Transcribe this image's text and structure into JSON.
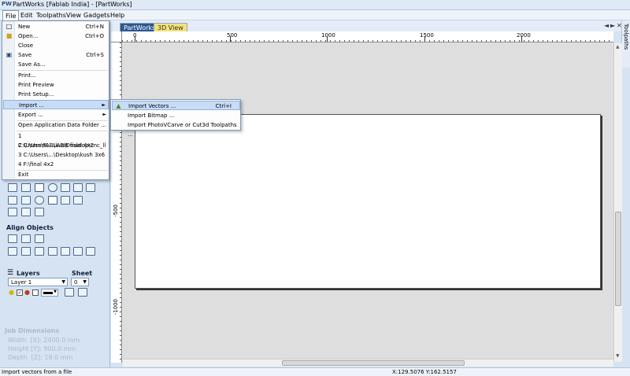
{
  "app": {
    "logo": "PW",
    "title": "PartWorks [Fablab India] - [PartWorks]"
  },
  "menubar": [
    "File",
    "Edit",
    "Toolpaths",
    "View",
    "Gadgets",
    "Help"
  ],
  "file_menu": {
    "new": "New",
    "new_sc": "Ctrl+N",
    "open": "Open...",
    "open_sc": "Ctrl+O",
    "close": "Close",
    "save": "Save",
    "save_sc": "Ctrl+S",
    "save_as": "Save As...",
    "print": "Print...",
    "print_preview": "Print Preview",
    "print_setup": "Print Setup...",
    "import": "Import ...",
    "export": "Export ...",
    "open_app_data": "Open Application Data Folder ...",
    "recent1": "1 C:\\Users\\FABLAB\\Desktop\\cnc_ll",
    "recent2": "2 C:\\Users\\...\\kush final 4x2",
    "recent3": "3 C:\\Users\\...\\Desktop\\kush 3x6",
    "recent4": "4 F:\\final 4x2",
    "exit": "Exit"
  },
  "import_menu": {
    "vectors": "Import Vectors ...",
    "vectors_sc": "Ctrl+I",
    "bitmap": "Import Bitmap ...",
    "toolpaths": "Import PhotoVCarve or Cut3d Toolpaths ..."
  },
  "tabs": {
    "partworks": "PartWorks",
    "view3d": "3D View"
  },
  "toolpaths_tab": "Toolpaths",
  "ruler": {
    "h": [
      "0",
      "500",
      "1000",
      "1500",
      "2000"
    ],
    "v": [
      "-500",
      "-1000"
    ]
  },
  "left_panel": {
    "align_heading": "Align Objects",
    "layers_heading": "Layers",
    "sheet_heading": "Sheet",
    "layer_value": "Layer 1",
    "sheet_value": "0",
    "job_dimensions": {
      "title": "Job Dimensions",
      "width": "Width  [X]: 2400.0 mm",
      "height": "Height [Y]: 900.0 mm",
      "depth": "Depth  [Z]: 19.0 mm"
    }
  },
  "status": {
    "message": "Import vectors from a file",
    "coords": "X:129.5076 Y:162.5157"
  },
  "colors": {
    "accent": "#2b5890",
    "panel": "#d6e3f2",
    "highlight": "#c9dcf5",
    "tab3d": "#f5e27a"
  }
}
